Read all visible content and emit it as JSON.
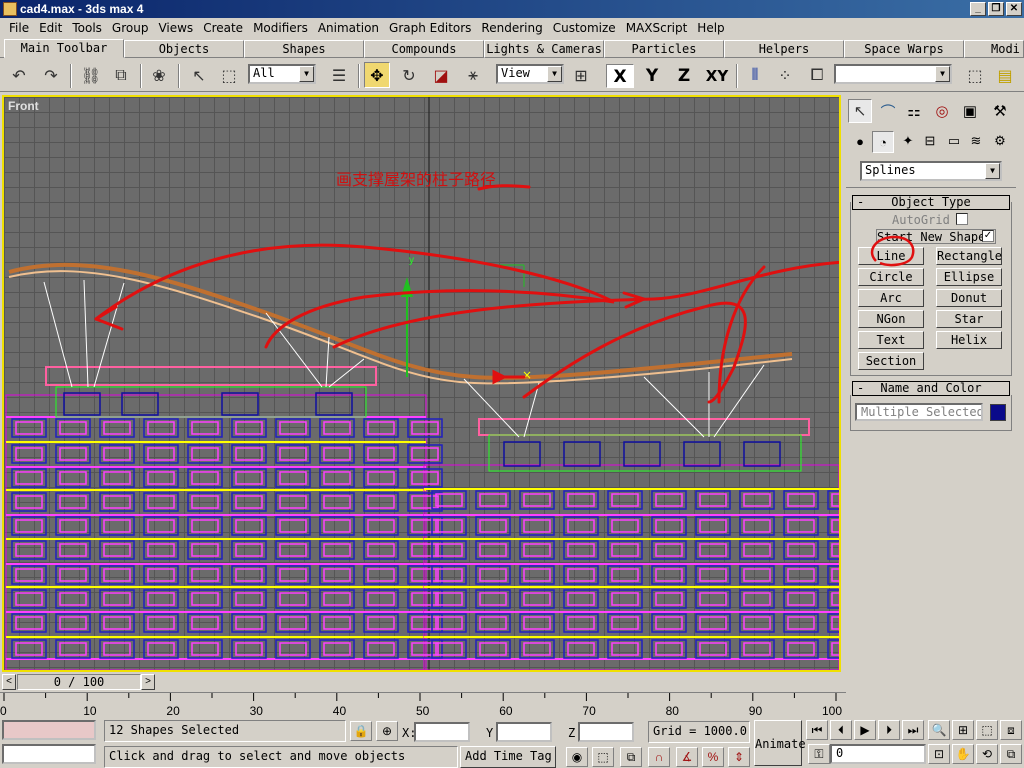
{
  "window": {
    "title": "cad4.max - 3ds max 4",
    "minimize": "_",
    "restore": "❐",
    "close": "✕"
  },
  "menu": [
    "File",
    "Edit",
    "Tools",
    "Group",
    "Views",
    "Create",
    "Modifiers",
    "Animation",
    "Graph Editors",
    "Rendering",
    "Customize",
    "MAXScript",
    "Help"
  ],
  "tabs": [
    "Main Toolbar",
    "Objects",
    "Shapes",
    "Compounds",
    "Lights & Cameras",
    "Particles",
    "Helpers",
    "Space Warps",
    "Modi"
  ],
  "toolbar": {
    "selection_filter": "All",
    "ref_coord": "View",
    "axis_x": "X",
    "axis_y": "Y",
    "axis_z": "Z",
    "axis_xy": "XY",
    "named_selection": ""
  },
  "viewport": {
    "label": "Front",
    "annotation": "画支撑屋架的柱子路径",
    "annotation_color": "#d01010"
  },
  "command_panel": {
    "category": "Splines",
    "object_type": {
      "title": "Object Type",
      "autogrid": "AutoGrid",
      "start_new_shape": "Start New Shape",
      "buttons": [
        "Line",
        "Rectangle",
        "Circle",
        "Ellipse",
        "Arc",
        "Donut",
        "NGon",
        "Star",
        "Text",
        "Helix",
        "Section"
      ]
    },
    "name_color": {
      "title": "Name and Color",
      "name_value": "Multiple Selected",
      "color": "#0a0a8a"
    },
    "collapse": "-"
  },
  "timeline": {
    "frame_display": "0 / 100",
    "prev": "<",
    "next": ">",
    "ticks": [
      "0",
      "10",
      "20",
      "30",
      "40",
      "50",
      "60",
      "70",
      "80",
      "90",
      "100"
    ]
  },
  "status": {
    "selection": "12 Shapes Selected",
    "prompt": "Click and drag to select and move objects",
    "x_label": "X:",
    "y_label": "Y:",
    "z_label": "Z:",
    "grid": "Grid = 1000.0",
    "add_time_tag": "Add Time Tag",
    "animate": "Animate",
    "frame": "0"
  }
}
